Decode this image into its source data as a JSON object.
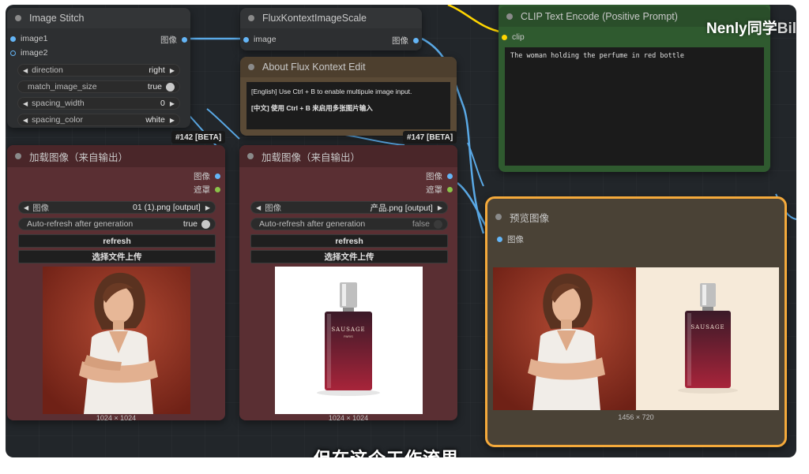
{
  "nodes": {
    "image_stitch": {
      "title": "Image Stitch",
      "inputs": [
        "image1",
        "image2"
      ],
      "output": "图像",
      "widgets": [
        {
          "label": "direction",
          "value": "right"
        },
        {
          "label": "match_image_size",
          "value": "true"
        },
        {
          "label": "spacing_width",
          "value": "0"
        },
        {
          "label": "spacing_color",
          "value": "white"
        }
      ]
    },
    "flux_scale": {
      "title": "FluxKontextImageScale",
      "input": "image",
      "output": "图像"
    },
    "about_note": {
      "title": "About Flux Kontext Edit",
      "line_en": "[English] Use Ctrl + B to enable multipule image input.",
      "line_zh": "[中文] 使用 Ctrl + B 来启用多张图片输入"
    },
    "load_image_1": {
      "badge": "#142 [BETA]",
      "title": "加载图像（来自输出）",
      "outputs": [
        "图像",
        "遮罩"
      ],
      "image_label": "图像",
      "image_value": "01 (1).png [output]",
      "refresh_label": "Auto-refresh after generation",
      "refresh_value": "true",
      "refresh_button": "refresh",
      "upload_button": "选择文件上传",
      "dims": "1024 × 1024"
    },
    "load_image_2": {
      "badge": "#147 [BETA]",
      "title": "加载图像（来自输出）",
      "outputs": [
        "图像",
        "遮罩"
      ],
      "image_label": "图像",
      "image_value": "产品.png [output]",
      "refresh_label": "Auto-refresh after generation",
      "refresh_value": "false",
      "refresh_button": "refresh",
      "upload_button": "选择文件上传",
      "dims": "1024 × 1024",
      "bottle_brand": "SAUSAGE",
      "bottle_sub": "PARIS"
    },
    "clip_encode": {
      "title": "CLIP Text Encode (Positive Prompt)",
      "input": "clip",
      "prompt": "The woman holding the perfume in red bottle"
    },
    "preview": {
      "title": "预览图像",
      "input": "图像",
      "dims": "1456 × 720",
      "bottle_brand": "SAUSAGE"
    }
  },
  "watermark": "Nenly同学",
  "watermark_tail": "Bil",
  "subtitle": "但在这个工作流里",
  "colors": {
    "canvas": "#22262a",
    "load_node": "#5a2f33",
    "load_title": "#4a2629",
    "note_node": "#5a4a36",
    "clip_node": "#2f5a2f",
    "preview_border": "#f4a93b",
    "image_socket": "#64b5f6",
    "clip_socket": "#ffd500"
  }
}
